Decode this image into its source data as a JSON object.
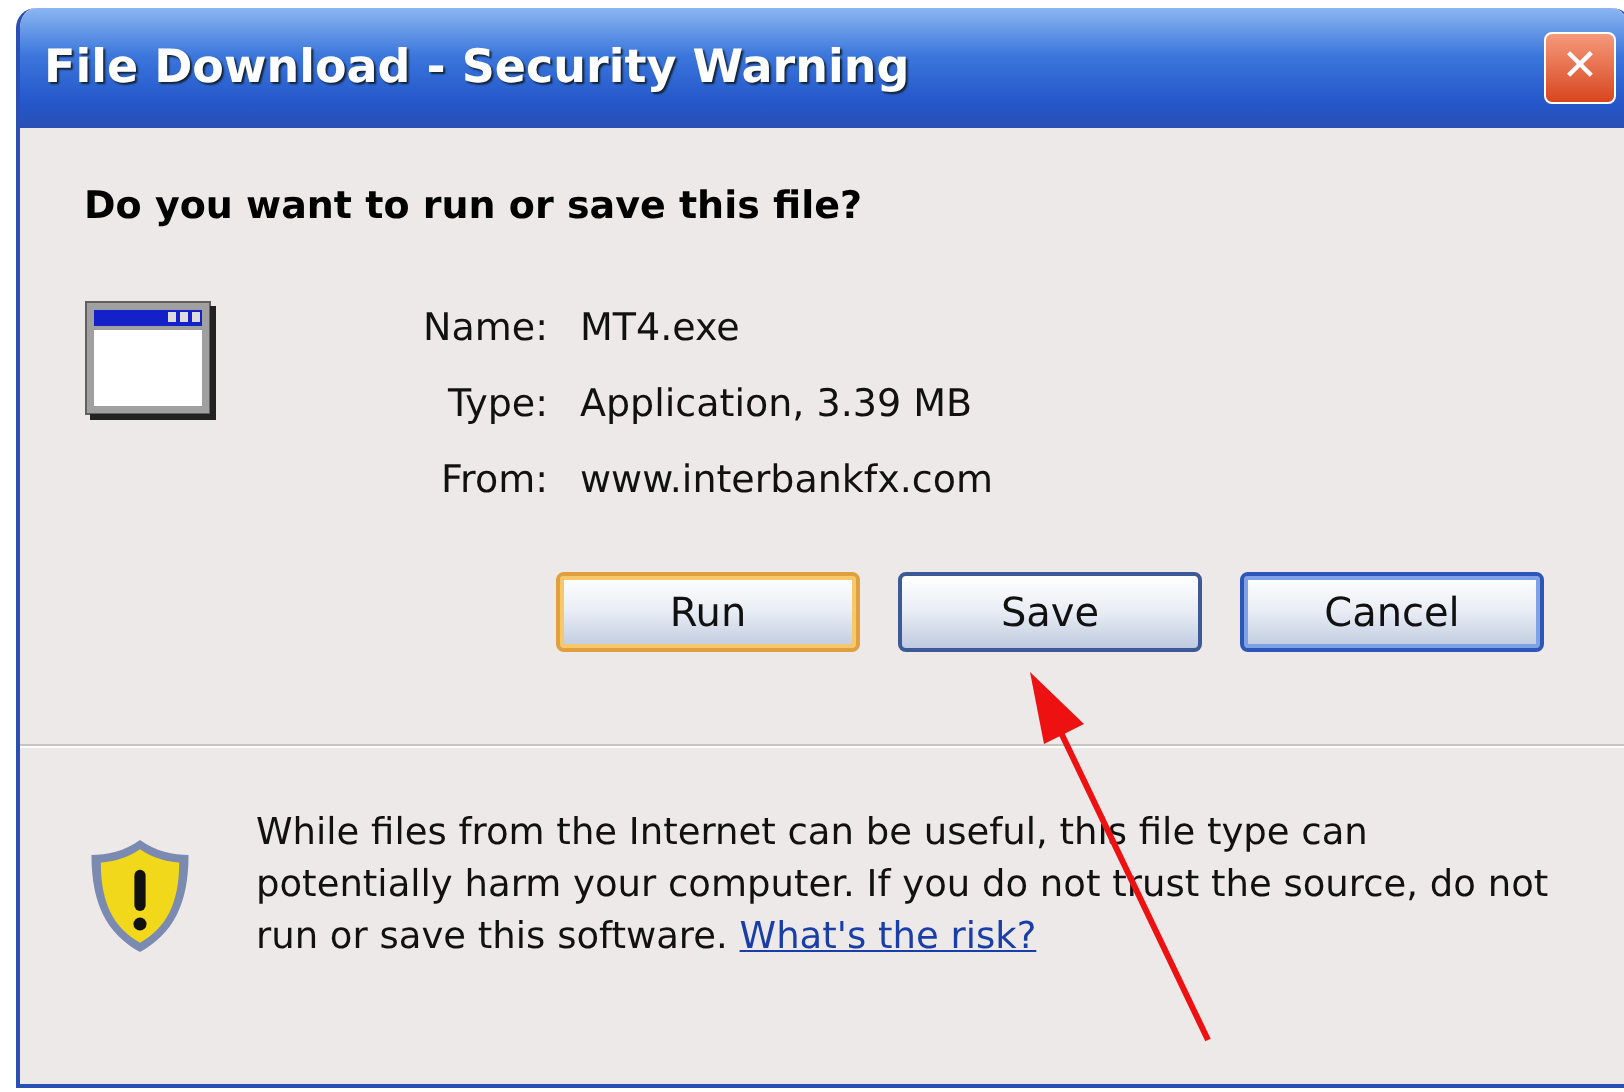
{
  "window": {
    "title": "File Download - Security Warning",
    "close": "✕"
  },
  "question": "Do you want to run or save this file?",
  "file": [
    {
      "label": "Name:",
      "value": "MT4.exe"
    },
    {
      "label": "Type:",
      "value": "Application, 3.39 MB"
    },
    {
      "label": "From:",
      "value": "www.interbankfx.com"
    }
  ],
  "buttons": [
    {
      "label": "Run",
      "kind": "hover"
    },
    {
      "label": "Save",
      "kind": "normal"
    },
    {
      "label": "Cancel",
      "kind": "default"
    }
  ],
  "warning": {
    "text": "While files from the Internet can be useful, this file type can potentially harm your computer. If you do not trust the source, do not run or save this software.",
    "link": "What's the risk?"
  },
  "pointer_arrow": true
}
